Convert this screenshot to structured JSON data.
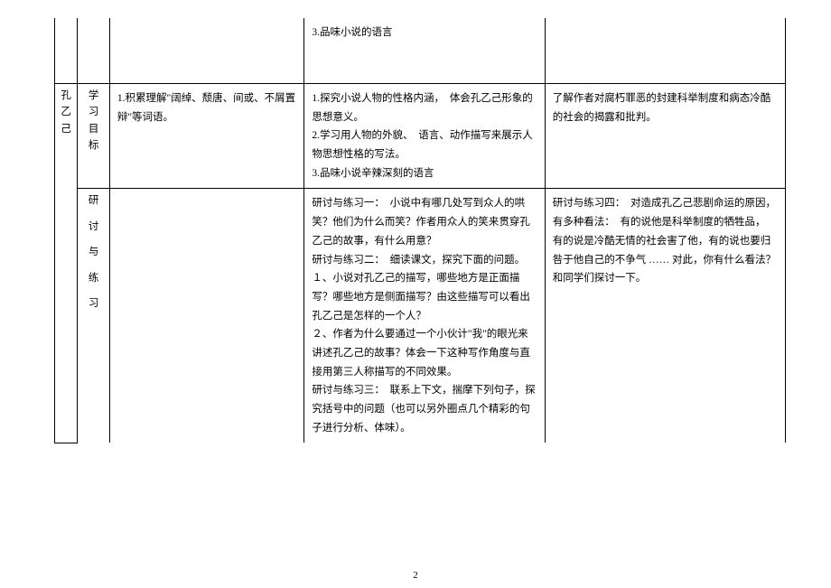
{
  "page_number": "2",
  "row_top": {
    "col_b": "3.品味小说的语言"
  },
  "spine": "孔乙己",
  "row_goals": {
    "label": "学习目标",
    "col_a": "1.积累理解\"阔绰、颓唐、间或、不屑置辩\"等词语。",
    "col_b": "1.探究小说人物的性格内涵，　体会孔乙己形象的思想意义。\n2.学习用人物的外貌、　语言、动作描写来展示人物思想性格的写法。\n3.品味小说辛辣深刻的语言",
    "col_c": "了解作者对腐朽罪恶的封建科举制度和病态冷酷的社会的揭露和批判。"
  },
  "row_practice": {
    "label": "研讨与练习",
    "col_b": "研讨与练习一：　小说中有哪几处写到众人的哄笑？他们为什么而笑？作者用众人的笑来贯穿孔乙己的故事，有什么用意？\n研讨与练习二：　细读课文，探究下面的问题。\n１、小说对孔乙己的描写，哪些地方是正面描写？哪些地方是侧面描写？由这些描写可以看出孔乙己是怎样的一个人？\n２、作者为什么要通过一个小伙计\"我\"的眼光来讲述孔乙己的故事？体会一下这种写作角度与直接用第三人称描写的不同效果。\n研讨与练习三：　联系上下文，揣摩下列句子，探究括号中的问题（也可以另外圈点几个精彩的句子进行分析、体味）。",
    "col_c": "研讨与练习四：　对造成孔乙己悲剧命运的原因，有多种看法：　有的说他是科举制度的牺牲品，　有的说是冷酷无情的社会害了他，有的说也要归咎于他自己的不争气 …… 对此，你有什么看法？和同学们探讨一下。"
  }
}
